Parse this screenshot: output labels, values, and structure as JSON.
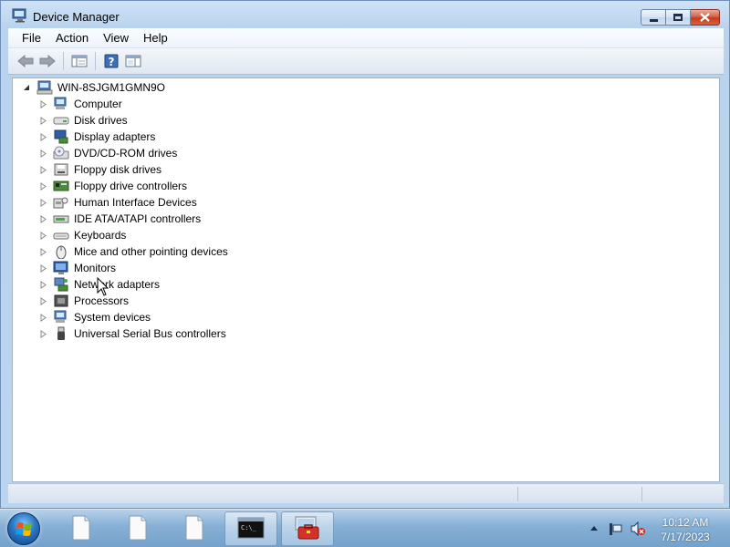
{
  "window": {
    "title": "Device Manager",
    "menu": [
      "File",
      "Action",
      "View",
      "Help"
    ]
  },
  "tree": {
    "root": "WIN-8SJGM1GMN9O",
    "items": [
      {
        "label": "Computer",
        "icon": "computer-icon"
      },
      {
        "label": "Disk drives",
        "icon": "disk-drive-icon"
      },
      {
        "label": "Display adapters",
        "icon": "display-adapter-icon"
      },
      {
        "label": "DVD/CD-ROM drives",
        "icon": "dvd-drive-icon"
      },
      {
        "label": "Floppy disk drives",
        "icon": "floppy-drive-icon"
      },
      {
        "label": "Floppy drive controllers",
        "icon": "floppy-controller-icon"
      },
      {
        "label": "Human Interface Devices",
        "icon": "hid-icon"
      },
      {
        "label": "IDE ATA/ATAPI controllers",
        "icon": "ide-controller-icon"
      },
      {
        "label": "Keyboards",
        "icon": "keyboard-icon"
      },
      {
        "label": "Mice and other pointing devices",
        "icon": "mouse-icon"
      },
      {
        "label": "Monitors",
        "icon": "monitor-icon"
      },
      {
        "label": "Network adapters",
        "icon": "network-adapter-icon"
      },
      {
        "label": "Processors",
        "icon": "processor-icon"
      },
      {
        "label": "System devices",
        "icon": "system-devices-icon"
      },
      {
        "label": "Universal Serial Bus controllers",
        "icon": "usb-icon"
      }
    ]
  },
  "taskbar": {
    "apps": [
      "file-icon",
      "file-icon",
      "file-icon",
      "command-prompt-icon",
      "device-manager-icon"
    ],
    "clock_time": "10:12 AM",
    "clock_date": "7/17/2023"
  }
}
